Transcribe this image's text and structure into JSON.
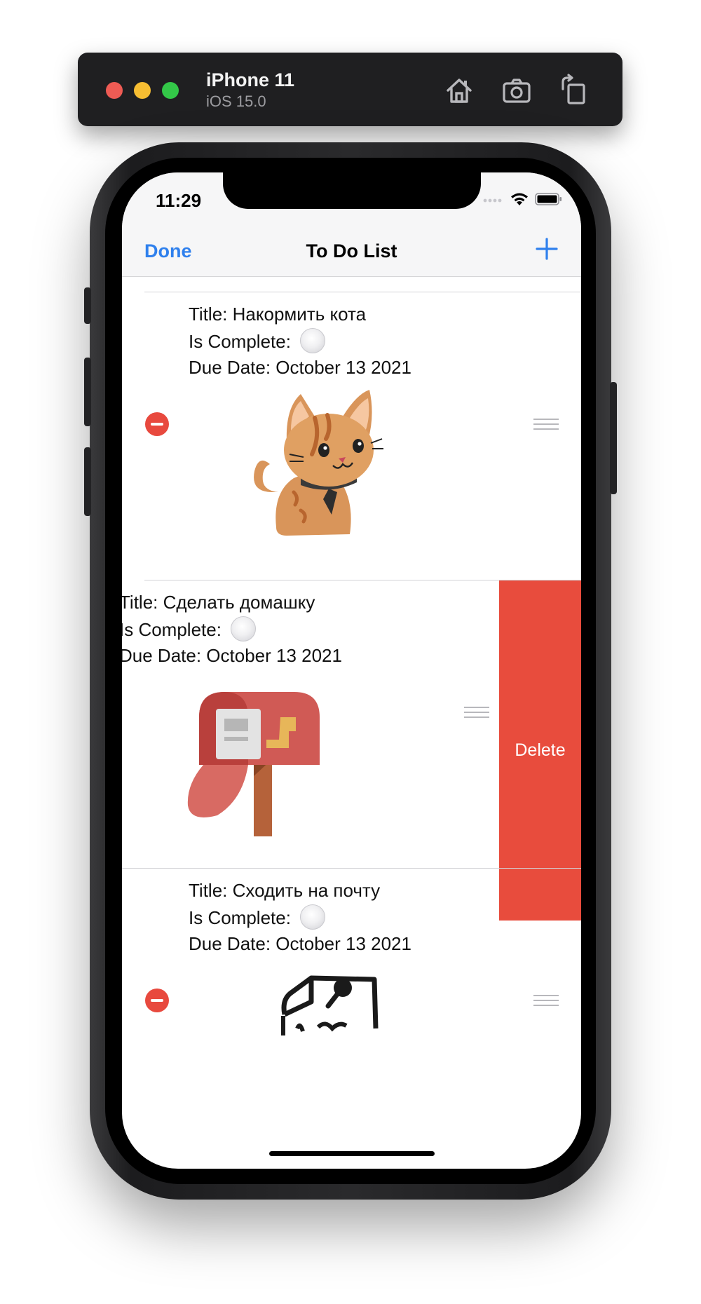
{
  "simulator": {
    "device_name": "iPhone 11",
    "os_version": "iOS 15.0",
    "toolbar_icons": [
      "home-icon",
      "screenshot-icon",
      "rotate-icon"
    ]
  },
  "status_bar": {
    "time": "11:29"
  },
  "navbar": {
    "left_button": "Done",
    "title": "To Do List",
    "right_button_icon": "plus-icon"
  },
  "colors": {
    "accent": "#2f80ed",
    "destructive": "#e84c3d"
  },
  "todos": [
    {
      "title_label": "Title: Накормить кота",
      "complete_label": "Is Complete:",
      "due_label": "Due Date: October 13 2021",
      "image": "cat-illustration"
    },
    {
      "title_label": "Title: Сделать домашку",
      "complete_label": "Is Complete:",
      "due_label": "Due Date: October 13 2021",
      "image": "mailbox-illustration",
      "swipe_action": "Delete"
    },
    {
      "title_label": "Title: Сходить на почту",
      "complete_label": "Is Complete:",
      "due_label": "Due Date: October 13 2021",
      "image": "letter-sketch-illustration"
    }
  ]
}
